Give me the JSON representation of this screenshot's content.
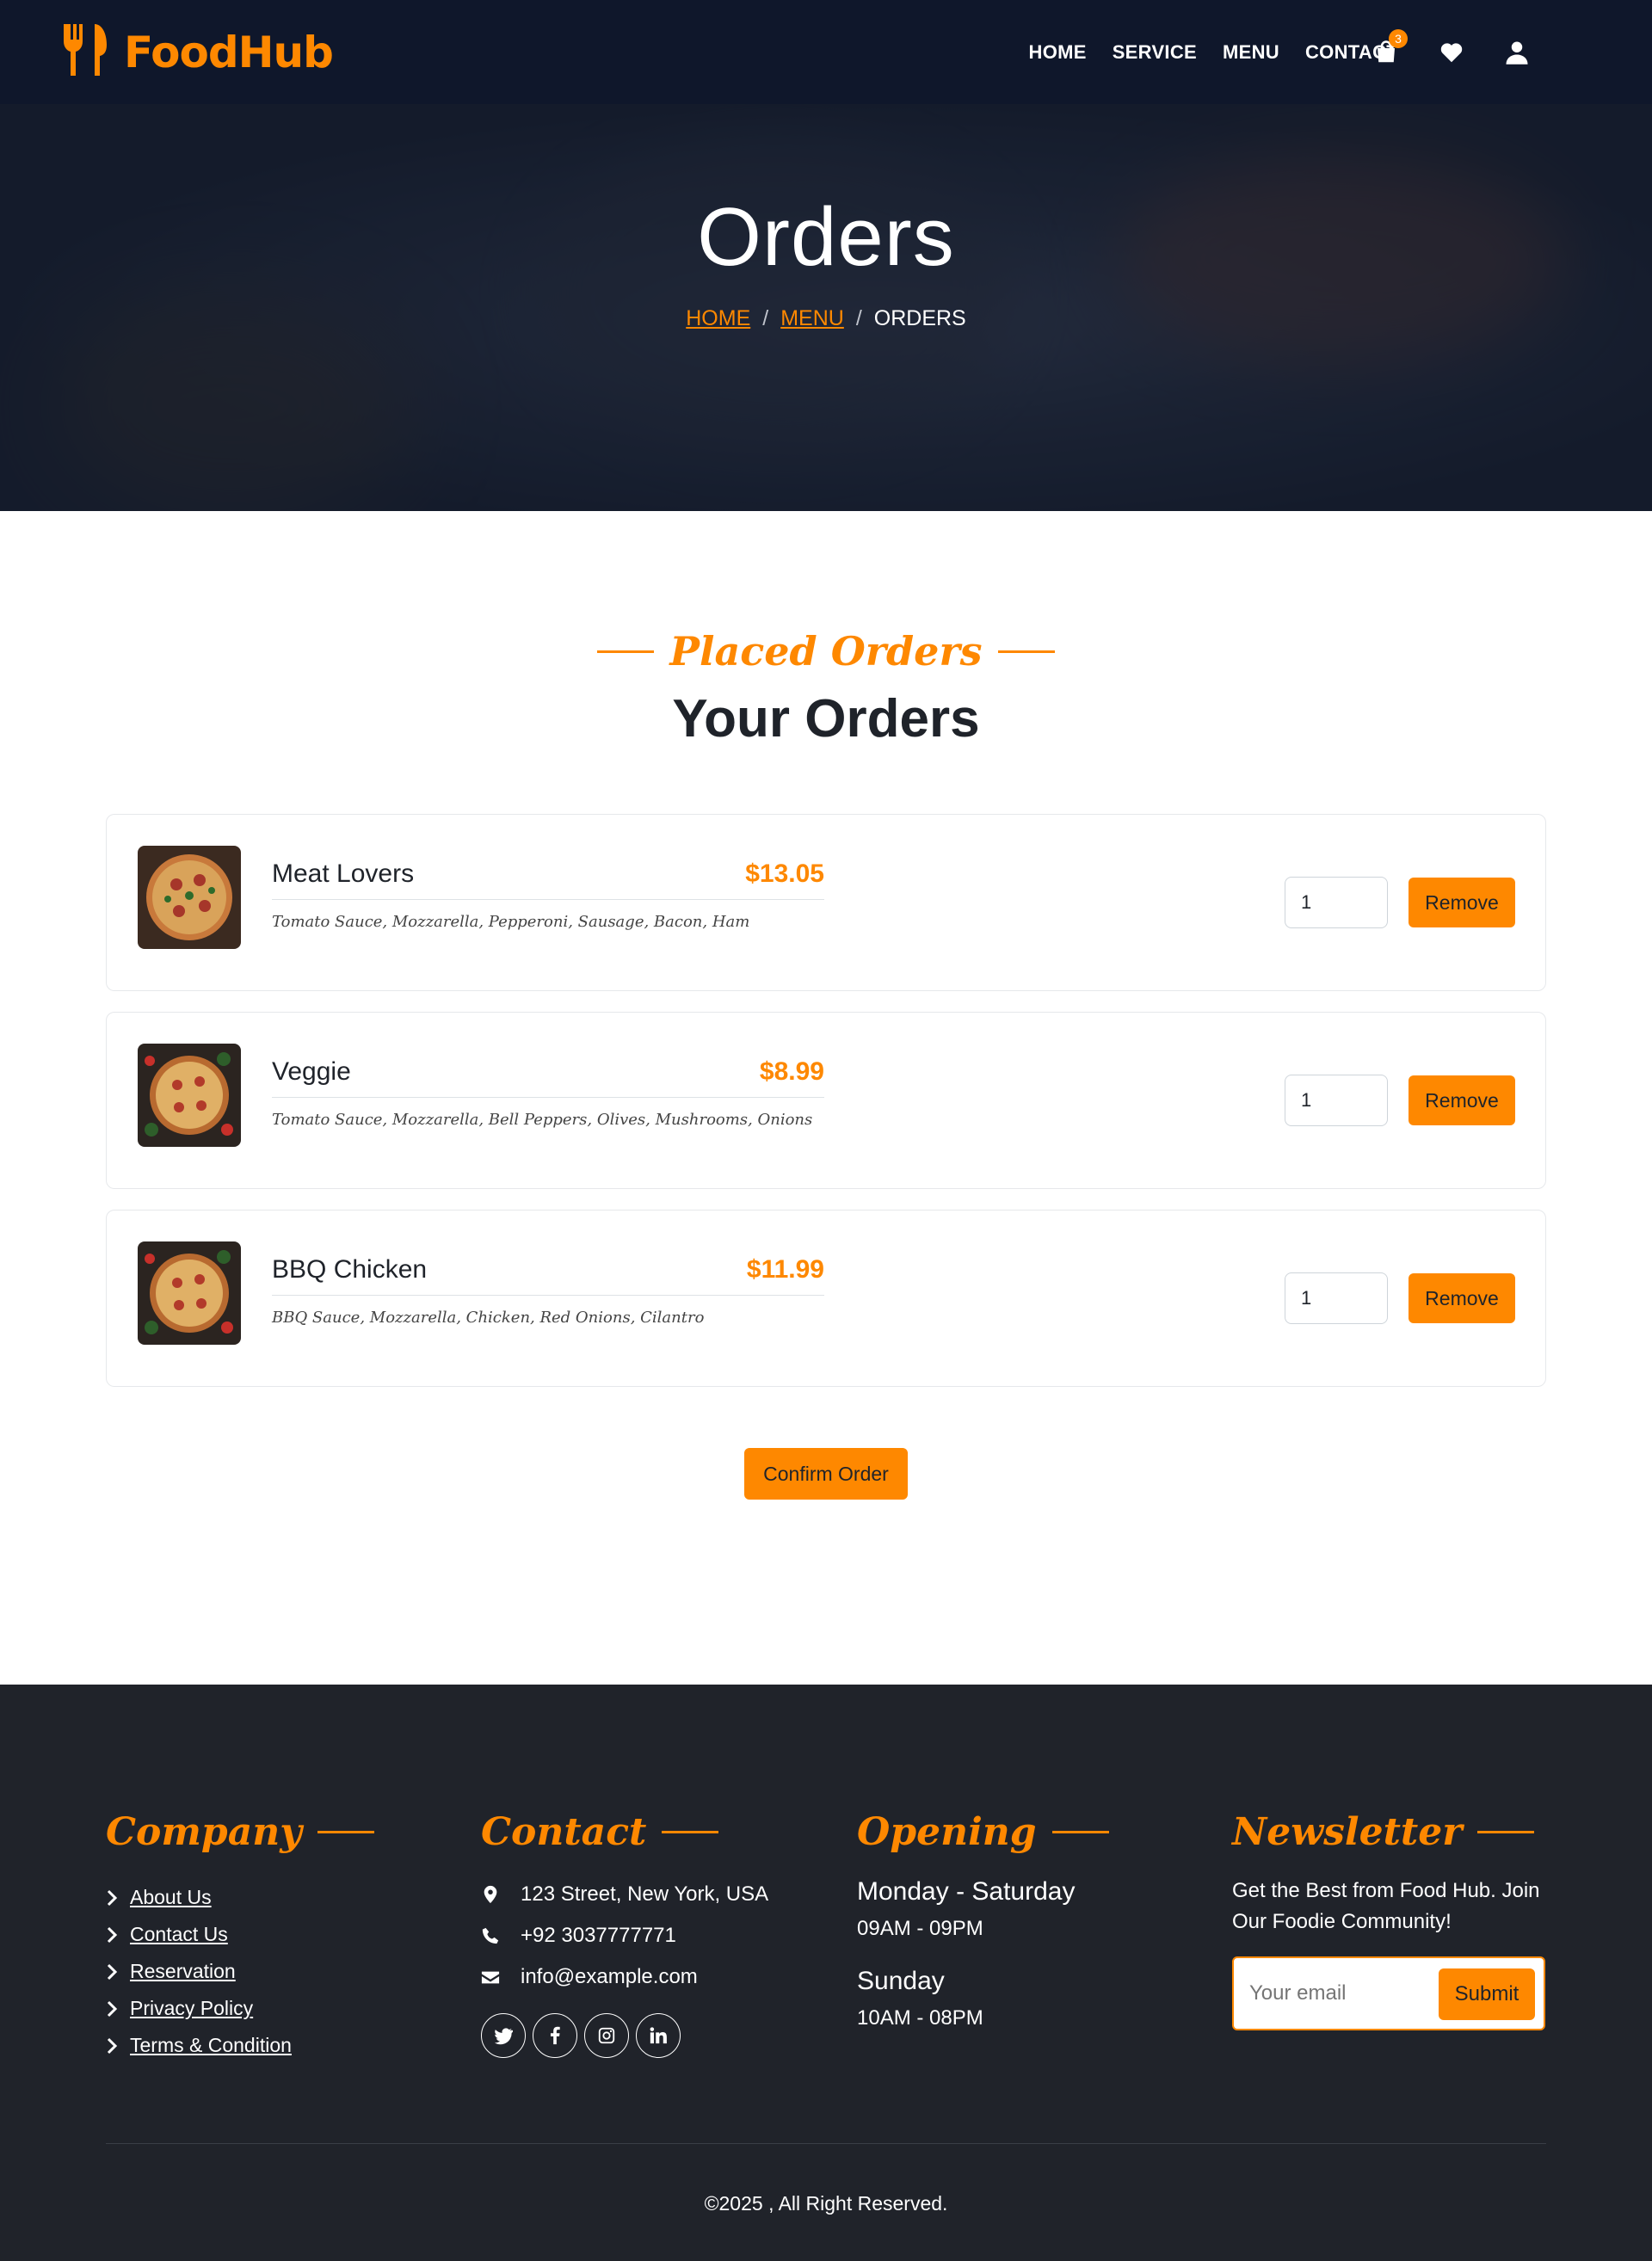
{
  "brand": {
    "name": "FoodHub",
    "icon": "utensils-icon",
    "accent": "#fe8800"
  },
  "nav": {
    "links": [
      "HOME",
      "SERVICE",
      "MENU",
      "CONTACT"
    ],
    "cart_count": "3",
    "icons": [
      "shopping-bag-icon",
      "heart-icon",
      "user-icon"
    ]
  },
  "hero": {
    "title": "Orders",
    "breadcrumb": {
      "home": "HOME",
      "menu": "MENU",
      "current": "ORDERS",
      "separator": "/"
    }
  },
  "section": {
    "subtitle": "Placed Orders",
    "title": "Your Orders"
  },
  "orders": [
    {
      "name": "Meat Lovers",
      "price": "$13.05",
      "desc": "Tomato Sauce, Mozzarella, Pepperoni, Sausage, Bacon, Ham",
      "qty": "1",
      "remove_label": "Remove"
    },
    {
      "name": "Veggie",
      "price": "$8.99",
      "desc": "Tomato Sauce, Mozzarella, Bell Peppers, Olives, Mushrooms, Onions",
      "qty": "1",
      "remove_label": "Remove"
    },
    {
      "name": "BBQ Chicken",
      "price": "$11.99",
      "desc": "BBQ Sauce, Mozzarella, Chicken, Red Onions, Cilantro",
      "qty": "1",
      "remove_label": "Remove"
    }
  ],
  "confirm_label": "Confirm Order",
  "footer": {
    "company": {
      "title": "Company",
      "links": [
        "About Us",
        "Contact Us",
        "Reservation",
        "Privacy Policy",
        "Terms & Condition"
      ]
    },
    "contact": {
      "title": "Contact",
      "address": "123 Street, New York, USA",
      "phone": "+92 3037777771",
      "email": "info@example.com",
      "socials": [
        "twitter-icon",
        "facebook-icon",
        "instagram-icon",
        "linkedin-icon"
      ]
    },
    "opening": {
      "title": "Opening",
      "weekday_label": "Monday - Saturday",
      "weekday_hours": "09AM - 09PM",
      "sunday_label": "Sunday",
      "sunday_hours": "10AM - 08PM"
    },
    "newsletter": {
      "title": "Newsletter",
      "text": "Get the Best from Food Hub. Join Our Foodie Community!",
      "placeholder": "Your email",
      "submit_label": "Submit"
    },
    "copyright": "©2025 , All Right Reserved."
  }
}
